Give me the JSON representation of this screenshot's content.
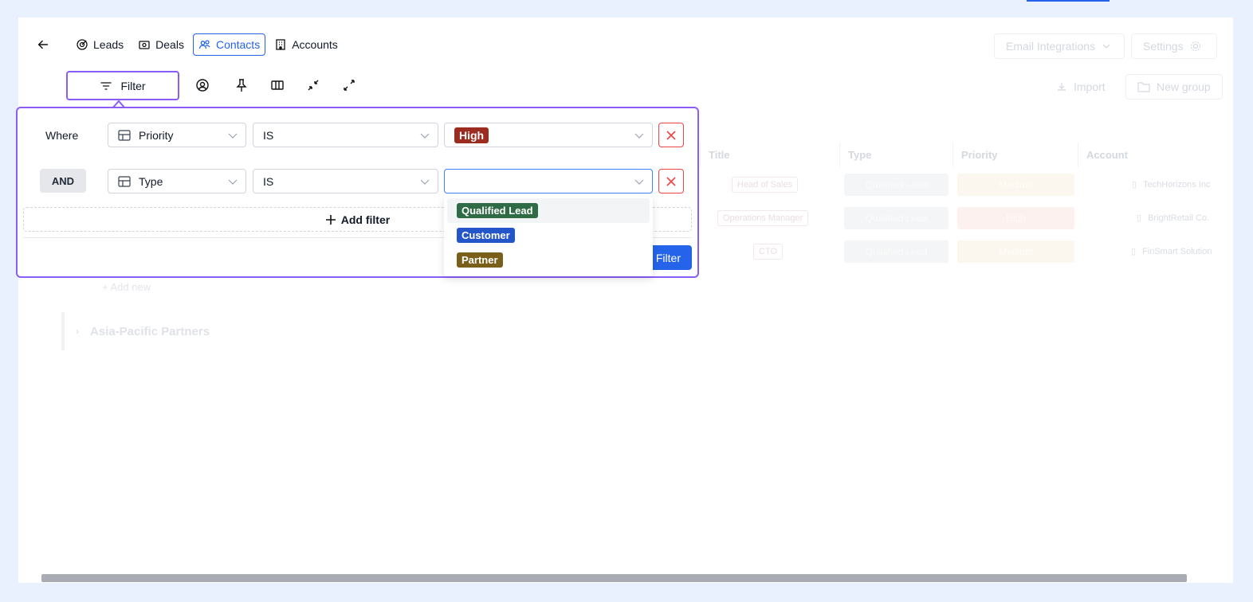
{
  "nav": {
    "items": [
      {
        "label": "Leads"
      },
      {
        "label": "Deals"
      },
      {
        "label": "Contacts"
      },
      {
        "label": "Accounts"
      }
    ]
  },
  "toolbar": {
    "filter_label": "Filter"
  },
  "background": {
    "email_integrations": "Email Integrations",
    "settings": "Settings",
    "import": "Import",
    "new_group": "New group",
    "columns": [
      "Title",
      "Type",
      "Priority",
      "Account"
    ],
    "rows": [
      {
        "title": "Head of Sales",
        "type": "Qualified Lead",
        "priority": "Medium",
        "account": "TechHorizons Inc"
      },
      {
        "title": "Operations Manager",
        "type": "Qualified Lead",
        "priority": "High",
        "account": "BrightRetail Co."
      },
      {
        "title": "CTO",
        "type": "Qualified Lead",
        "priority": "Medium",
        "account": "FinSmart Solution"
      }
    ],
    "add_new": "Add new",
    "group_name": "Asia-Pacific Partners"
  },
  "filter_panel": {
    "where_label": "Where",
    "and_label": "AND",
    "rows": [
      {
        "field": "Priority",
        "operator": "IS",
        "value": "High",
        "value_color": "#9b2c1f"
      },
      {
        "field": "Type",
        "operator": "IS",
        "value": ""
      }
    ],
    "add_filter_label": "Add filter",
    "apply_label": "Filter",
    "dropdown_options": [
      {
        "label": "Qualified Lead",
        "color": "#2f6b45"
      },
      {
        "label": "Customer",
        "color": "#2456c9"
      },
      {
        "label": "Partner",
        "color": "#7a5f1a"
      }
    ]
  }
}
